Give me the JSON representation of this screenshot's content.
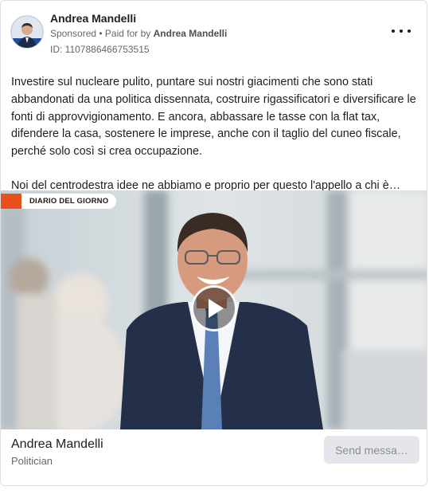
{
  "post": {
    "page_name": "Andrea Mandelli",
    "sponsored_label": "Sponsored",
    "separator": " • ",
    "paid_for_prefix": "Paid for by ",
    "paid_for_by": "Andrea Mandelli",
    "ad_id_text": "ID: 1107886466753515",
    "more_icon": "more-horizontal-icon",
    "paragraph_1": "Investire sul nucleare pulito, puntare sui nostri giacimenti che sono stati abbandonati da una politica dissennata, costruire rigassificatori e diversificare le fonti di approvvigionamento. E ancora, abbassare le tasse con la flat tax, difendere la casa, sostenere le imprese, anche con il taglio del cuneo fiscale, perché solo così si crea occupazione.",
    "paragraph_2": "Noi del centrodestra idee ne abbiamo e proprio per questo l'appello a chi è…"
  },
  "video": {
    "badge_text": "DIARIO DEL GIORNO",
    "badge_color": "#e8501c",
    "play_icon": "play-icon"
  },
  "footer": {
    "name": "Andrea Mandelli",
    "category": "Politician",
    "cta_label": "Send messa…"
  }
}
